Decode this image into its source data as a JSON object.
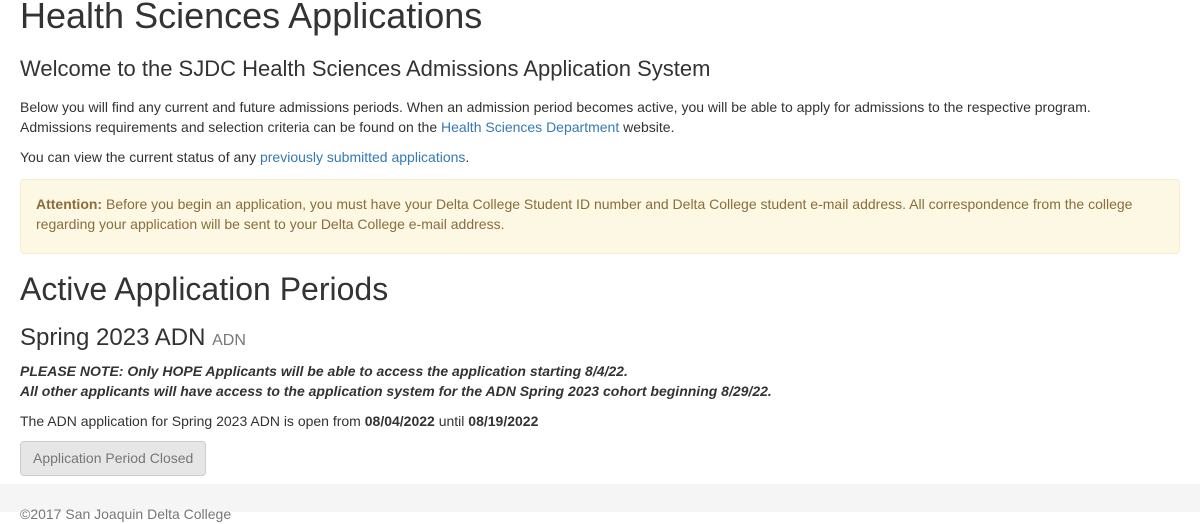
{
  "header": {
    "title": "Health Sciences Applications",
    "subtitle": "Welcome to the SJDC Health Sciences Admissions Application System"
  },
  "intro": {
    "line1": "Below you will find any current and future admissions periods. When an admission period becomes active, you will be able to apply for admissions to the respective program.",
    "line2_before": "Admissions requirements and selection criteria can be found on the ",
    "dept_link": "Health Sciences Department",
    "line2_after": " website.",
    "status_before": "You can view the current status of any ",
    "status_link": "previously submitted applications",
    "status_after": "."
  },
  "attention": {
    "label": "Attention:",
    "text": " Before you begin an application, you must have your Delta College Student ID number and Delta College student e-mail address. All correspondence from the college regarding your application will be sent to your Delta College e-mail address."
  },
  "active_periods": {
    "heading": "Active Application Periods",
    "periods": [
      {
        "name": "Spring 2023 ADN",
        "program": "ADN",
        "note_line1": "PLEASE NOTE: Only HOPE Applicants will be able to access the application starting 8/4/22.",
        "note_line2": "All other applicants will have access to the application system for the ADN Spring 2023 cohort beginning 8/29/22.",
        "open_text_before": "The ADN application for Spring 2023 ADN is open from ",
        "start_date": "08/04/2022",
        "open_text_middle": " until ",
        "end_date": "08/19/2022",
        "button_label": "Application Period Closed"
      }
    ]
  },
  "footer": {
    "copyright": "©2017 San Joaquin Delta College"
  }
}
